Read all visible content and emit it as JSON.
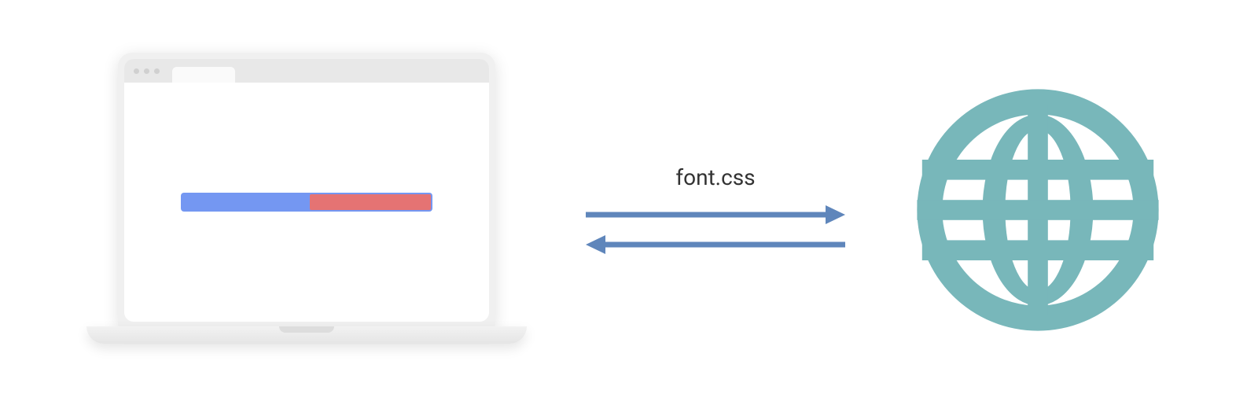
{
  "label": "font.css",
  "progress": {
    "blue_color": "#7497f2",
    "red_color": "#e57373",
    "red_portion": 0.48
  },
  "arrow_color": "#5f86bb",
  "globe_color": "#78b7ba"
}
